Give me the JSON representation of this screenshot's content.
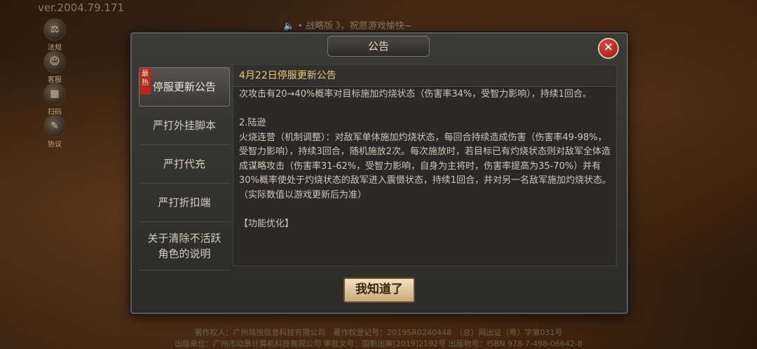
{
  "version": "ver.2004.79.171",
  "side_icons": [
    {
      "label": "法规",
      "icon": "law-icon"
    },
    {
      "label": "客服",
      "icon": "service-icon"
    },
    {
      "label": "扫码",
      "icon": "scan-icon"
    },
    {
      "label": "协议",
      "icon": "agreement-icon"
    }
  ],
  "marquee": "🔈 • 战略版 》，祝愿游戏愉快~",
  "dialog": {
    "title": "公告",
    "close_symbol": "✕",
    "tabs": [
      {
        "label": "停服更新公告",
        "badge": "最热",
        "active": true
      },
      {
        "label": "严打外挂脚本"
      },
      {
        "label": "严打代充"
      },
      {
        "label": "严打折扣端"
      },
      {
        "label": "关于清除不活跃角色的说明"
      }
    ],
    "content_title": "4月22日停服更新公告",
    "content_lines": [
      "次攻击有20→40%概率对目标施加灼烧状态（伤害率34%，受智力影响），持续1回合。",
      "",
      "2.陆逊",
      "火烧连营（机制调整）：对敌军单体施加灼烧状态，每回合持续造成伤害（伤害率49-98%，受智力影响），持续3回合，随机施放2次。每次施放时，若目标已有灼烧状态则对敌军全体造成谋略攻击（伤害率31-62%，受智力影响，自身为主将时，伤害率提高为35-70%）并有30%概率使处于灼烧状态的敌军进入震慑状态，持续1回合，并对另一名敌军施加灼烧状态。",
      "（实际数值以游戏更新后为准）",
      "",
      "【功能优化】"
    ],
    "ok_label": "我知道了"
  },
  "footer": {
    "line1": "著作权人：广州简悦信息科技有限公司　著作权登记号：2019SR0240448　（总）网出证（粤）字第031号",
    "line2": "出版单位：广州市动景计算机科技有限公司 审批文号：国新出审[2019]2192号 出版物号：ISBN 978-7-498-06642-8"
  }
}
